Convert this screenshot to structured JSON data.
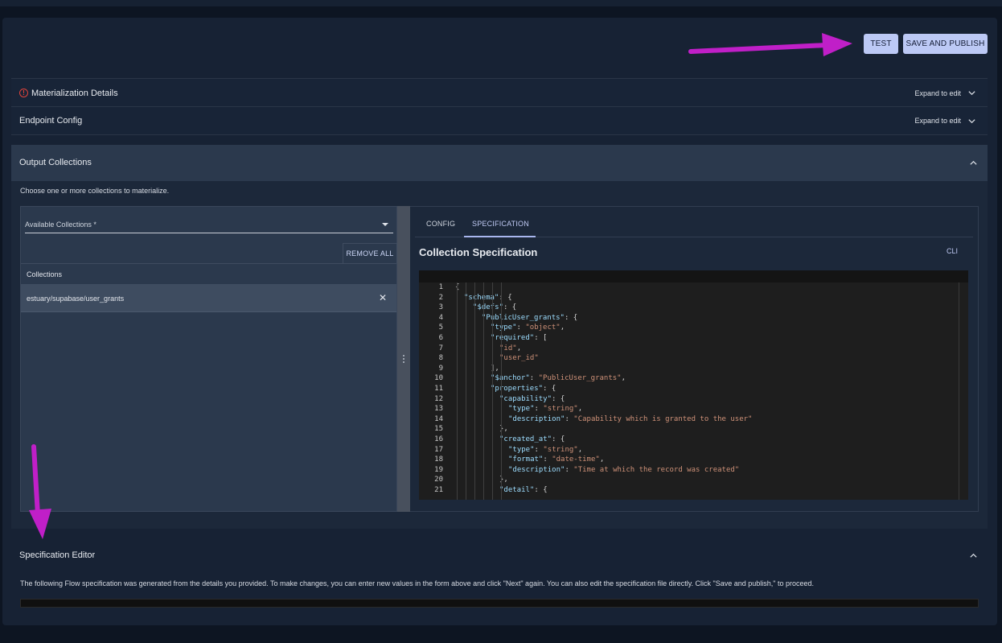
{
  "toolbar": {
    "test_label": "TEST",
    "save_label": "SAVE AND PUBLISH"
  },
  "sections": {
    "materialization_details": {
      "title": "Materialization Details",
      "action": "Expand to edit"
    },
    "endpoint_config": {
      "title": "Endpoint Config",
      "action": "Expand to edit"
    },
    "output_collections": {
      "title": "Output Collections",
      "description": "Choose one or more collections to materialize.",
      "select_label": "Available Collections *",
      "remove_all_label": "REMOVE ALL",
      "list_header": "Collections",
      "items": [
        "estuary/supabase/user_grants"
      ],
      "tabs": [
        "CONFIG",
        "SPECIFICATION"
      ],
      "spec_title": "Collection Specification",
      "cli_label": "CLI"
    },
    "specification_editor": {
      "title": "Specification Editor",
      "description": "The following Flow specification was generated from the details you provided. To make changes, you can enter new values in the form above and click \"Next\" again. You can also edit the specification file directly. Click \"Save and publish,\" to proceed."
    }
  },
  "code": [
    {
      "n": "1",
      "i": 0,
      "parts": [
        [
          "p",
          "{"
        ]
      ]
    },
    {
      "n": "2",
      "i": 1,
      "parts": [
        [
          "k",
          "\"schema\""
        ],
        [
          "p",
          ": {"
        ]
      ]
    },
    {
      "n": "3",
      "i": 2,
      "parts": [
        [
          "k",
          "\"$defs\""
        ],
        [
          "p",
          ": {"
        ]
      ]
    },
    {
      "n": "4",
      "i": 3,
      "parts": [
        [
          "k",
          "\"PublicUser_grants\""
        ],
        [
          "p",
          ": {"
        ]
      ]
    },
    {
      "n": "5",
      "i": 4,
      "parts": [
        [
          "k",
          "\"type\""
        ],
        [
          "p",
          ": "
        ],
        [
          "s",
          "\"object\""
        ],
        [
          "p",
          ","
        ]
      ]
    },
    {
      "n": "6",
      "i": 4,
      "parts": [
        [
          "k",
          "\"required\""
        ],
        [
          "p",
          ": ["
        ]
      ]
    },
    {
      "n": "7",
      "i": 5,
      "parts": [
        [
          "s",
          "\"id\""
        ],
        [
          "p",
          ","
        ]
      ]
    },
    {
      "n": "8",
      "i": 5,
      "parts": [
        [
          "s",
          "\"user_id\""
        ]
      ]
    },
    {
      "n": "9",
      "i": 4,
      "parts": [
        [
          "p",
          "],"
        ]
      ]
    },
    {
      "n": "10",
      "i": 4,
      "parts": [
        [
          "k",
          "\"$anchor\""
        ],
        [
          "p",
          ": "
        ],
        [
          "s",
          "\"PublicUser_grants\""
        ],
        [
          "p",
          ","
        ]
      ]
    },
    {
      "n": "11",
      "i": 4,
      "parts": [
        [
          "k",
          "\"properties\""
        ],
        [
          "p",
          ": {"
        ]
      ]
    },
    {
      "n": "12",
      "i": 5,
      "parts": [
        [
          "k",
          "\"capability\""
        ],
        [
          "p",
          ": {"
        ]
      ]
    },
    {
      "n": "13",
      "i": 6,
      "parts": [
        [
          "k",
          "\"type\""
        ],
        [
          "p",
          ": "
        ],
        [
          "s",
          "\"string\""
        ],
        [
          "p",
          ","
        ]
      ]
    },
    {
      "n": "14",
      "i": 6,
      "parts": [
        [
          "k",
          "\"description\""
        ],
        [
          "p",
          ": "
        ],
        [
          "s",
          "\"Capability which is granted to the user\""
        ]
      ]
    },
    {
      "n": "15",
      "i": 5,
      "parts": [
        [
          "p",
          "},"
        ]
      ]
    },
    {
      "n": "16",
      "i": 5,
      "parts": [
        [
          "k",
          "\"created_at\""
        ],
        [
          "p",
          ": {"
        ]
      ]
    },
    {
      "n": "17",
      "i": 6,
      "parts": [
        [
          "k",
          "\"type\""
        ],
        [
          "p",
          ": "
        ],
        [
          "s",
          "\"string\""
        ],
        [
          "p",
          ","
        ]
      ]
    },
    {
      "n": "18",
      "i": 6,
      "parts": [
        [
          "k",
          "\"format\""
        ],
        [
          "p",
          ": "
        ],
        [
          "s",
          "\"date-time\""
        ],
        [
          "p",
          ","
        ]
      ]
    },
    {
      "n": "19",
      "i": 6,
      "parts": [
        [
          "k",
          "\"description\""
        ],
        [
          "p",
          ": "
        ],
        [
          "s",
          "\"Time at which the record was created\""
        ]
      ]
    },
    {
      "n": "20",
      "i": 5,
      "parts": [
        [
          "p",
          "},"
        ]
      ]
    },
    {
      "n": "21",
      "i": 5,
      "parts": [
        [
          "k",
          "\"detail\""
        ],
        [
          "p",
          ": {"
        ]
      ]
    }
  ],
  "colors": {
    "accent": "#bcc9f5",
    "annotation_arrow": "#c01fc8",
    "warning": "#e0433b",
    "json_key": "#9cdcfe",
    "json_string": "#ce9178"
  },
  "icons": [
    "warning-circle-icon",
    "chevron-down-icon",
    "chevron-up-icon",
    "dropdown-caret-icon",
    "close-icon",
    "drag-handle-icon",
    "annotation-arrow"
  ]
}
